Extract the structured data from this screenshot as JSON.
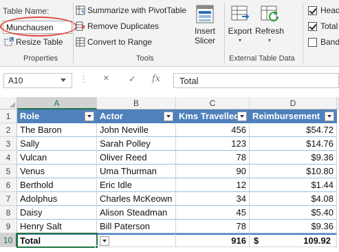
{
  "ribbon": {
    "properties": {
      "table_name_label": "Table Name:",
      "table_name_value": "Munchausen",
      "resize_table": "Resize Table",
      "group_label": "Properties"
    },
    "tools": {
      "summarize": "Summarize with PivotTable",
      "remove_duplicates": "Remove Duplicates",
      "convert_to_range": "Convert to Range",
      "insert_slicer_line1": "Insert",
      "insert_slicer_line2": "Slicer",
      "group_label": "Tools"
    },
    "external": {
      "export": "Export",
      "refresh": "Refresh",
      "group_label": "External Table Data"
    },
    "style_options": {
      "header_row": "Head",
      "total_row": "Total",
      "banded_rows": "Band",
      "header_row_checked": true,
      "total_row_checked": true,
      "banded_rows_checked": false
    }
  },
  "formula_bar": {
    "name_box": "A10",
    "cancel_icon": "×",
    "enter_icon": "✓",
    "fx_label": "fx",
    "formula": "Total"
  },
  "grid": {
    "columns": [
      "A",
      "B",
      "C",
      "D"
    ],
    "rows": [
      "1",
      "2",
      "3",
      "4",
      "5",
      "6",
      "7",
      "8",
      "9",
      "10"
    ],
    "headers": [
      "Role",
      "Actor",
      "Kms Travelled",
      "Reimbursement"
    ],
    "data": [
      [
        "The Baron",
        "John Neville",
        "456",
        "$54.72"
      ],
      [
        "Sally",
        "Sarah Polley",
        "123",
        "$14.76"
      ],
      [
        "Vulcan",
        "Oliver Reed",
        "78",
        "$9.36"
      ],
      [
        "Venus",
        "Uma Thurman",
        "90",
        "$10.80"
      ],
      [
        "Berthold",
        "Eric Idle",
        "12",
        "$1.44"
      ],
      [
        "Adolphus",
        "Charles McKeown",
        "34",
        "$4.08"
      ],
      [
        "Daisy",
        "Alison Steadman",
        "45",
        "$5.40"
      ],
      [
        "Henry Salt",
        "Bill Paterson",
        "78",
        "$9.36"
      ]
    ],
    "total_row": {
      "label": "Total",
      "kms": "916",
      "currency": "$",
      "amount": "109.92"
    }
  },
  "colors": {
    "table_header": "#4f81bd",
    "excel_green": "#217346",
    "highlight_ring": "#e04a43"
  }
}
